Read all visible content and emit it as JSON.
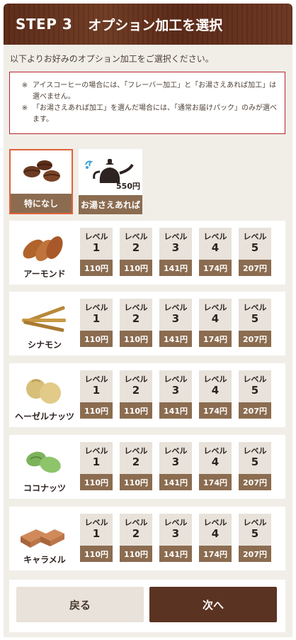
{
  "header": {
    "step": "STEP 3",
    "title": "オプション加工を選択"
  },
  "intro": "以下よりお好みのオプション加工をご選択ください。",
  "notes": [
    {
      "mark": "※",
      "lines": [
        "アイスコーヒーの場合には、「フレーバー加工」と「お湯さえあれば加工」は",
        "選べません。"
      ]
    },
    {
      "mark": "※",
      "lines": [
        "「お湯さえあれば加工」を選んだ場合には、「通常お届けパック」のみが選べ",
        "ます。"
      ]
    }
  ],
  "options": [
    {
      "label": "特になし",
      "selected": true
    },
    {
      "label": "お湯さえあれば",
      "price": "550円",
      "selected": false
    }
  ],
  "level_word": "レベル",
  "flavors": [
    {
      "name": "アーモンド",
      "icon": "almond-icon",
      "levels": [
        {
          "num": "1",
          "price": "110円"
        },
        {
          "num": "2",
          "price": "110円"
        },
        {
          "num": "3",
          "price": "141円"
        },
        {
          "num": "4",
          "price": "174円"
        },
        {
          "num": "5",
          "price": "207円"
        }
      ]
    },
    {
      "name": "シナモン",
      "icon": "cinnamon-icon",
      "levels": [
        {
          "num": "1",
          "price": "110円"
        },
        {
          "num": "2",
          "price": "110円"
        },
        {
          "num": "3",
          "price": "141円"
        },
        {
          "num": "4",
          "price": "174円"
        },
        {
          "num": "5",
          "price": "207円"
        }
      ]
    },
    {
      "name": "ヘーゼルナッツ",
      "icon": "hazelnut-icon",
      "levels": [
        {
          "num": "1",
          "price": "110円"
        },
        {
          "num": "2",
          "price": "110円"
        },
        {
          "num": "3",
          "price": "141円"
        },
        {
          "num": "4",
          "price": "174円"
        },
        {
          "num": "5",
          "price": "207円"
        }
      ]
    },
    {
      "name": "ココナッツ",
      "icon": "coconut-icon",
      "levels": [
        {
          "num": "1",
          "price": "110円"
        },
        {
          "num": "2",
          "price": "110円"
        },
        {
          "num": "3",
          "price": "141円"
        },
        {
          "num": "4",
          "price": "174円"
        },
        {
          "num": "5",
          "price": "207円"
        }
      ]
    },
    {
      "name": "キャラメル",
      "icon": "caramel-icon",
      "levels": [
        {
          "num": "1",
          "price": "110円"
        },
        {
          "num": "2",
          "price": "110円"
        },
        {
          "num": "3",
          "price": "141円"
        },
        {
          "num": "4",
          "price": "174円"
        },
        {
          "num": "5",
          "price": "207円"
        }
      ]
    }
  ],
  "buttons": {
    "back": "戻る",
    "next": "次へ"
  },
  "colors": {
    "header": "#5b2a17",
    "accent": "#8b6c50",
    "selected_border": "#e0623a",
    "note_border": "#b5232c",
    "next_button": "#5b3322"
  }
}
